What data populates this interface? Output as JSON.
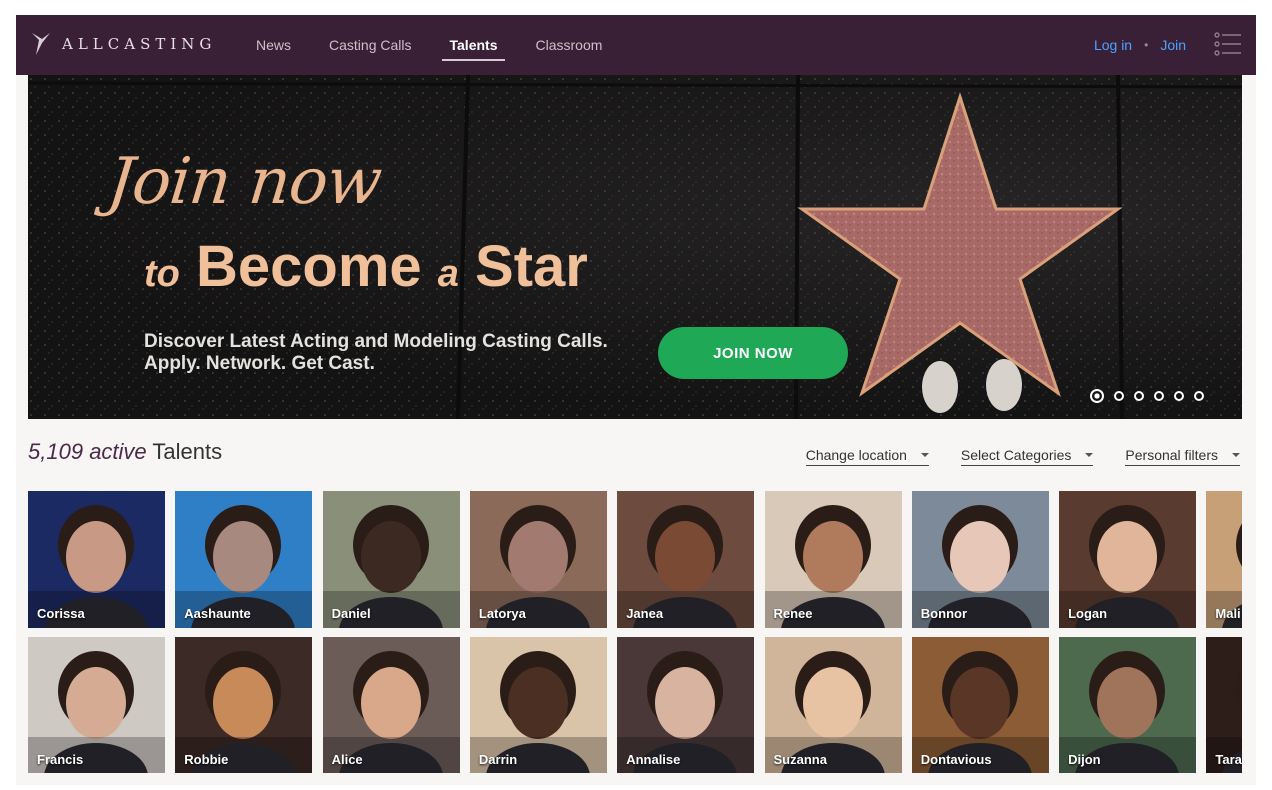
{
  "brand": {
    "name": "ALLCASTING"
  },
  "nav": {
    "items": [
      {
        "label": "News",
        "active": false
      },
      {
        "label": "Casting Calls",
        "active": false
      },
      {
        "label": "Talents",
        "active": true
      },
      {
        "label": "Classroom",
        "active": false
      }
    ],
    "login_label": "Log in",
    "separator": "•",
    "join_label": "Join",
    "link_color": "#4aa3ff"
  },
  "hero": {
    "line1": "Join now",
    "line2_prefix": "to",
    "line2_main1": "Become",
    "line2_small": "a",
    "line2_main2": "Star",
    "sub_line1": "Discover Latest Acting and Modeling Casting Calls.",
    "sub_line2": "Apply. Network. Get Cast.",
    "cta_label": "JOIN NOW",
    "cta_color": "#1fa856",
    "slide_count": 6,
    "active_slide": 1
  },
  "talents": {
    "count": "5,109",
    "count_suffix": "active",
    "label": "Talents",
    "filters": [
      "Change location",
      "Select Categories",
      "Personal filters"
    ],
    "row1": [
      {
        "name": "Corissa",
        "bg": "#1c2a63",
        "skin": "#c89a86"
      },
      {
        "name": "Aashaunte",
        "bg": "#2f7fc7",
        "skin": "#a7897f"
      },
      {
        "name": "Daniel",
        "bg": "#8a8f7a",
        "skin": "#3c2a22"
      },
      {
        "name": "Latorya",
        "bg": "#8b6a5a",
        "skin": "#a27a70"
      },
      {
        "name": "Janea",
        "bg": "#6d4b3f",
        "skin": "#7a4a35"
      },
      {
        "name": "Renee",
        "bg": "#d8c9b8",
        "skin": "#b07a5c"
      },
      {
        "name": "Bonnor",
        "bg": "#7d8a99",
        "skin": "#e6c7b8"
      },
      {
        "name": "Logan",
        "bg": "#5a3b30",
        "skin": "#e0b59a"
      },
      {
        "name": "Mali",
        "bg": "#c7a078",
        "skin": "#5a3a2a"
      }
    ],
    "row2": [
      {
        "name": "Francis",
        "bg": "#cfc9c4",
        "skin": "#d6ab94"
      },
      {
        "name": "Robbie",
        "bg": "#3b2a25",
        "skin": "#c98a5a"
      },
      {
        "name": "Alice",
        "bg": "#6b5c58",
        "skin": "#d9a78a"
      },
      {
        "name": "Darrin",
        "bg": "#d9c3a9",
        "skin": "#4a2f22"
      },
      {
        "name": "Annalise",
        "bg": "#4a3838",
        "skin": "#d8b39f"
      },
      {
        "name": "Suzanna",
        "bg": "#d1b59a",
        "skin": "#e7c2a3"
      },
      {
        "name": "Dontavious",
        "bg": "#8c5c36",
        "skin": "#5a3626"
      },
      {
        "name": "Dijon",
        "bg": "#4d6a4f",
        "skin": "#a0745a"
      },
      {
        "name": "Tara",
        "bg": "#2d1e1a",
        "skin": "#b07a5a"
      }
    ]
  }
}
